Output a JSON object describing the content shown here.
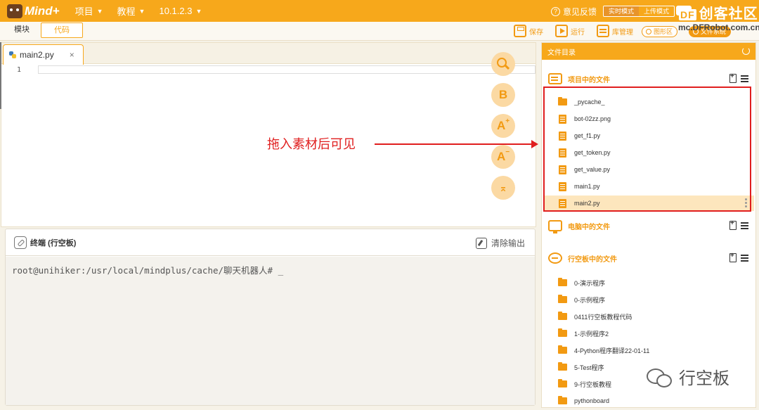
{
  "app": {
    "logo_text": "Mind+",
    "menu": [
      {
        "label": "项目"
      },
      {
        "label": "教程"
      },
      {
        "label": "10.1.2.3"
      }
    ],
    "feedback_label": "意见反馈",
    "modes": [
      "实时模式",
      "上传模式"
    ],
    "watermark_logo": "创客社区",
    "watermark_logo_prefix": "DF",
    "watermark_url": "mc.DFRobot.com.cn"
  },
  "toolbar": {
    "tab_blocks": "模块",
    "tab_code": "代码",
    "save_label": "保存",
    "run_label": "运行",
    "library_label": "库管理",
    "graph_label": "图形区",
    "files_label": "文件系统"
  },
  "editor": {
    "tab_name": "main2.py",
    "tab_close": "×",
    "line_numbers": [
      "1"
    ],
    "fab_bold": "B",
    "fab_font_up": "A",
    "fab_font_down": "A",
    "fab_sup_plus": "+",
    "fab_sup_minus": "−",
    "fab_top": "⌅"
  },
  "annotation": {
    "text": "拖入素材后可见"
  },
  "terminal": {
    "title": "终端 (行空板)",
    "clear_label": "清除输出",
    "prompt": "root@unihiker:/usr/local/mindplus/cache/聊天机器人# _"
  },
  "panel": {
    "title": "文件目录",
    "project_section": "项目中的文件",
    "project_files": [
      {
        "name": "_pycache_",
        "type": "folder"
      },
      {
        "name": "bot-02zz.png",
        "type": "file"
      },
      {
        "name": "get_f1.py",
        "type": "file"
      },
      {
        "name": "get_token.py",
        "type": "file"
      },
      {
        "name": "get_value.py",
        "type": "file"
      },
      {
        "name": "main1.py",
        "type": "file"
      },
      {
        "name": "main2.py",
        "type": "file",
        "selected": true
      }
    ],
    "computer_section": "电脑中的文件",
    "board_section": "行空板中的文件",
    "board_files": [
      {
        "name": "0-演示程序",
        "type": "folder"
      },
      {
        "name": "0-示例程序",
        "type": "folder"
      },
      {
        "name": "0411行空板教程代码",
        "type": "folder"
      },
      {
        "name": "1-示例程序2",
        "type": "folder"
      },
      {
        "name": "4-Python程序翻译22-01-11",
        "type": "folder"
      },
      {
        "name": "5-Test程序",
        "type": "folder"
      },
      {
        "name": "9-行空板教程",
        "type": "folder"
      },
      {
        "name": "pythonboard",
        "type": "folder"
      }
    ]
  },
  "wechat_watermark": "行空板",
  "colors": {
    "accent": "#f7a81b",
    "annotation": "#e01e1e",
    "selected_row": "#fde6bd"
  }
}
